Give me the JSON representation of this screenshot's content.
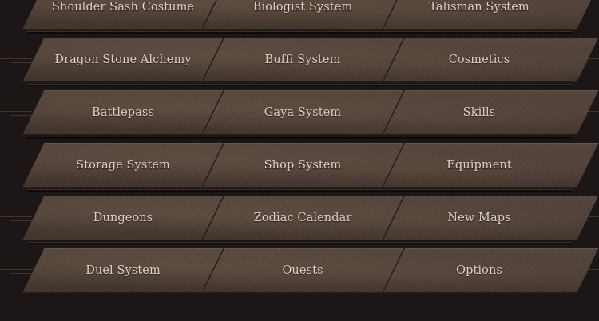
{
  "menu": {
    "rows": [
      [
        "Shoulder Sash Costume",
        "Biologist System",
        "Talisman System"
      ],
      [
        "Dragon Stone Alchemy",
        "Buffi System",
        "Cosmetics"
      ],
      [
        "Battlepass",
        "Gaya System",
        "Skills"
      ],
      [
        "Storage System",
        "Shop System",
        "Equipment"
      ],
      [
        "Dungeons",
        "Zodiac Calendar",
        "New Maps"
      ],
      [
        "Duel System",
        "Quests",
        "Options"
      ]
    ]
  }
}
